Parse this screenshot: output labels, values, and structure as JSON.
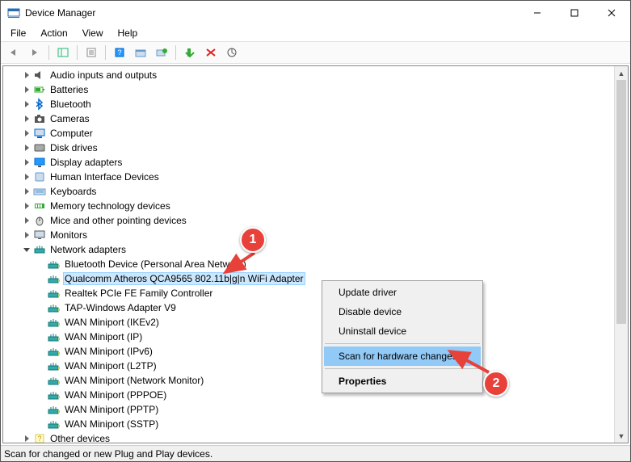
{
  "window": {
    "title": "Device Manager"
  },
  "menubar": {
    "items": [
      "File",
      "Action",
      "View",
      "Help"
    ]
  },
  "toolbar": {
    "buttons": [
      {
        "name": "back-button"
      },
      {
        "name": "forward-button"
      },
      {
        "name": "show-hide-tree-button"
      },
      {
        "name": "properties-button"
      },
      {
        "name": "help-button"
      },
      {
        "name": "update-driver-button"
      },
      {
        "name": "uninstall-button"
      },
      {
        "name": "disable-button"
      },
      {
        "name": "scan-hardware-button"
      }
    ]
  },
  "tree": {
    "categories": [
      {
        "label": "Audio inputs and outputs",
        "icon": "audio-icon",
        "expanded": false
      },
      {
        "label": "Batteries",
        "icon": "battery-icon",
        "expanded": false
      },
      {
        "label": "Bluetooth",
        "icon": "bluetooth-icon",
        "expanded": false
      },
      {
        "label": "Cameras",
        "icon": "camera-icon",
        "expanded": false
      },
      {
        "label": "Computer",
        "icon": "computer-icon",
        "expanded": false
      },
      {
        "label": "Disk drives",
        "icon": "disk-icon",
        "expanded": false
      },
      {
        "label": "Display adapters",
        "icon": "display-icon",
        "expanded": false
      },
      {
        "label": "Human Interface Devices",
        "icon": "hid-icon",
        "expanded": false
      },
      {
        "label": "Keyboards",
        "icon": "keyboard-icon",
        "expanded": false
      },
      {
        "label": "Memory technology devices",
        "icon": "memory-icon",
        "expanded": false
      },
      {
        "label": "Mice and other pointing devices",
        "icon": "mouse-icon",
        "expanded": false
      },
      {
        "label": "Monitors",
        "icon": "monitor-icon",
        "expanded": false
      },
      {
        "label": "Network adapters",
        "icon": "network-icon",
        "expanded": true,
        "children": [
          {
            "label": "Bluetooth Device (Personal Area Network)"
          },
          {
            "label": "Qualcomm Atheros QCA9565 802.11b|g|n WiFi Adapter",
            "selected": true
          },
          {
            "label": "Realtek PCIe FE Family Controller"
          },
          {
            "label": "TAP-Windows Adapter V9"
          },
          {
            "label": "WAN Miniport (IKEv2)"
          },
          {
            "label": "WAN Miniport (IP)"
          },
          {
            "label": "WAN Miniport (IPv6)"
          },
          {
            "label": "WAN Miniport (L2TP)"
          },
          {
            "label": "WAN Miniport (Network Monitor)"
          },
          {
            "label": "WAN Miniport (PPPOE)"
          },
          {
            "label": "WAN Miniport (PPTP)"
          },
          {
            "label": "WAN Miniport (SSTP)"
          }
        ]
      },
      {
        "label": "Other devices",
        "icon": "other-icon",
        "expanded": false
      }
    ]
  },
  "context_menu": {
    "items": [
      {
        "label": "Update driver"
      },
      {
        "label": "Disable device"
      },
      {
        "label": "Uninstall device"
      },
      {
        "label": "Scan for hardware changes",
        "highlight": true
      },
      {
        "label": "Properties",
        "bold": true
      }
    ]
  },
  "statusbar": {
    "text": "Scan for changed or new Plug and Play devices."
  },
  "annotations": {
    "badge1": "1",
    "badge2": "2"
  },
  "colors": {
    "accent": "#cce8ff",
    "highlight": "#91c9f7",
    "badge": "#e8413a"
  }
}
